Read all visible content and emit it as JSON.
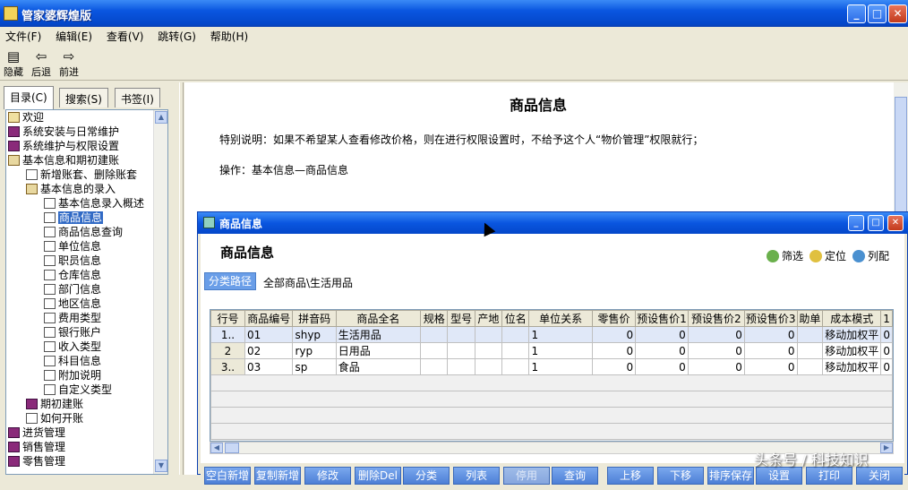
{
  "window": {
    "title": "管家婆辉煌版",
    "btn_min": "_",
    "btn_max": "□",
    "btn_close": "✕"
  },
  "menu": [
    "文件(F)",
    "编辑(E)",
    "查看(V)",
    "跳转(G)",
    "帮助(H)"
  ],
  "toolbar": {
    "hide": "隐藏",
    "back": "后退",
    "forward": "前进",
    "hide_icon": "▤",
    "back_icon": "⇦",
    "forward_icon": "⇨"
  },
  "tabs": [
    "目录(C)",
    "搜索(S)",
    "书签(I)"
  ],
  "tree": [
    {
      "label": "欢迎",
      "icon": "help-icon",
      "level": 0
    },
    {
      "label": "系统安装与日常维护",
      "icon": "book-icon",
      "level": 0
    },
    {
      "label": "系统维护与权限设置",
      "icon": "book-icon",
      "level": 0
    },
    {
      "label": "基本信息和期初建账",
      "icon": "open-book-icon",
      "level": 0
    },
    {
      "label": "新增账套、删除账套",
      "icon": "page-icon",
      "level": 1
    },
    {
      "label": "基本信息的录入",
      "icon": "open-book-icon",
      "level": 1
    },
    {
      "label": "基本信息录入概述",
      "icon": "page-icon",
      "level": 2
    },
    {
      "label": "商品信息",
      "icon": "page-icon",
      "level": 2,
      "selected": true
    },
    {
      "label": "商品信息查询",
      "icon": "page-icon",
      "level": 2
    },
    {
      "label": "单位信息",
      "icon": "page-icon",
      "level": 2
    },
    {
      "label": "职员信息",
      "icon": "page-icon",
      "level": 2
    },
    {
      "label": "仓库信息",
      "icon": "page-icon",
      "level": 2
    },
    {
      "label": "部门信息",
      "icon": "page-icon",
      "level": 2
    },
    {
      "label": "地区信息",
      "icon": "page-icon",
      "level": 2
    },
    {
      "label": "费用类型",
      "icon": "page-icon",
      "level": 2
    },
    {
      "label": "银行账户",
      "icon": "page-icon",
      "level": 2
    },
    {
      "label": "收入类型",
      "icon": "page-icon",
      "level": 2
    },
    {
      "label": "科目信息",
      "icon": "page-icon",
      "level": 2
    },
    {
      "label": "附加说明",
      "icon": "page-icon",
      "level": 2
    },
    {
      "label": "自定义类型",
      "icon": "page-icon",
      "level": 2
    },
    {
      "label": "期初建账",
      "icon": "book-icon",
      "level": 1
    },
    {
      "label": "如何开账",
      "icon": "page-icon",
      "level": 1
    },
    {
      "label": "进货管理",
      "icon": "book-icon",
      "level": 0
    },
    {
      "label": "销售管理",
      "icon": "book-icon",
      "level": 0
    },
    {
      "label": "零售管理",
      "icon": "book-icon",
      "level": 0
    }
  ],
  "content": {
    "title": "商品信息",
    "note": "特别说明：如果不希望某人查看修改价格，则在进行权限设置时，不给予这个人“物价管理”权限就行；",
    "operation": "操作：基本信息—商品信息"
  },
  "inner": {
    "title": "商品信息",
    "heading": "商品信息",
    "actions": {
      "filter": "筛选",
      "locate": "定位",
      "columns": "列配"
    },
    "path_button": "分类路径",
    "path": "全部商品\\生活用品",
    "columns": [
      "行号",
      "商品编号",
      "拼音码",
      "商品全名",
      "规格",
      "型号",
      "产地",
      "位名",
      "单位关系",
      "零售价",
      "预设售价1",
      "预设售价2",
      "预设售价3",
      "助单",
      "成本模式",
      "1"
    ],
    "rows": [
      [
        "1..",
        "01",
        "shyp",
        "生活用品",
        "",
        "",
        "",
        "",
        "1",
        "0",
        "0",
        "0",
        "0",
        "",
        "移动加权平",
        "0"
      ],
      [
        "2",
        "02",
        "ryp",
        "日用品",
        "",
        "",
        "",
        "",
        "1",
        "0",
        "0",
        "0",
        "0",
        "",
        "移动加权平",
        "0"
      ],
      [
        "3..",
        "03",
        "sp",
        "食品",
        "",
        "",
        "",
        "",
        "1",
        "0",
        "0",
        "0",
        "0",
        "",
        "移动加权平",
        "0"
      ]
    ],
    "buttons": [
      "空白新增",
      "复制新增",
      "修改",
      "删除Del",
      "分类",
      "列表",
      "停用",
      "查询",
      "上移",
      "下移",
      "排序保存",
      "设置",
      "打印",
      "关闭"
    ]
  },
  "watermark": "头条号 / 科技知识"
}
